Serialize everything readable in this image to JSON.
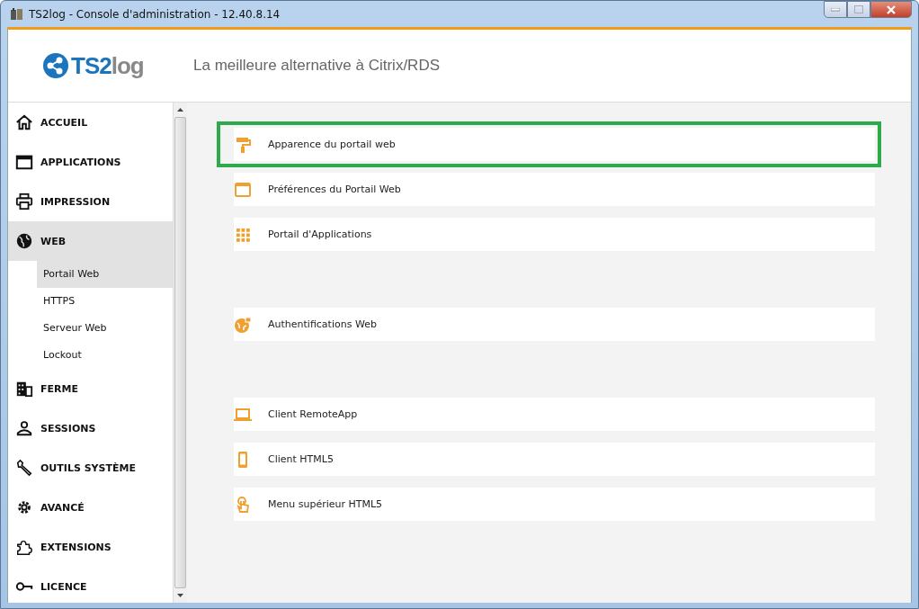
{
  "window": {
    "title": "TS2log - Console d'administration - 12.40.8.14"
  },
  "header": {
    "logo_text_1": "TS2",
    "logo_text_2": "log",
    "tagline": "La meilleure alternative à Citrix/RDS"
  },
  "sidebar": {
    "items": [
      {
        "label": "ACCUEIL",
        "selected": false
      },
      {
        "label": "APPLICATIONS",
        "selected": false
      },
      {
        "label": "IMPRESSION",
        "selected": false
      },
      {
        "label": "WEB",
        "selected": true,
        "expanded": true,
        "children": [
          {
            "label": "Portail Web",
            "selected": true
          },
          {
            "label": "HTTPS",
            "selected": false
          },
          {
            "label": "Serveur Web",
            "selected": false
          },
          {
            "label": "Lockout",
            "selected": false
          }
        ]
      },
      {
        "label": "FERME",
        "selected": false
      },
      {
        "label": "SESSIONS",
        "selected": false
      },
      {
        "label": "OUTILS SYSTÈME",
        "selected": false
      },
      {
        "label": "AVANCÉ",
        "selected": false
      },
      {
        "label": "EXTENSIONS",
        "selected": false
      },
      {
        "label": "LICENCE",
        "selected": false
      }
    ]
  },
  "content": {
    "groups": [
      [
        {
          "label": "Apparence du portail web",
          "selected": true
        },
        {
          "label": "Préférences du Portail Web",
          "selected": false
        },
        {
          "label": "Portail d'Applications",
          "selected": false
        }
      ],
      [
        {
          "label": "Authentifications Web",
          "selected": false
        }
      ],
      [
        {
          "label": "Client RemoteApp",
          "selected": false
        },
        {
          "label": "Client HTML5",
          "selected": false
        },
        {
          "label": "Menu supérieur HTML5",
          "selected": false
        }
      ]
    ]
  }
}
